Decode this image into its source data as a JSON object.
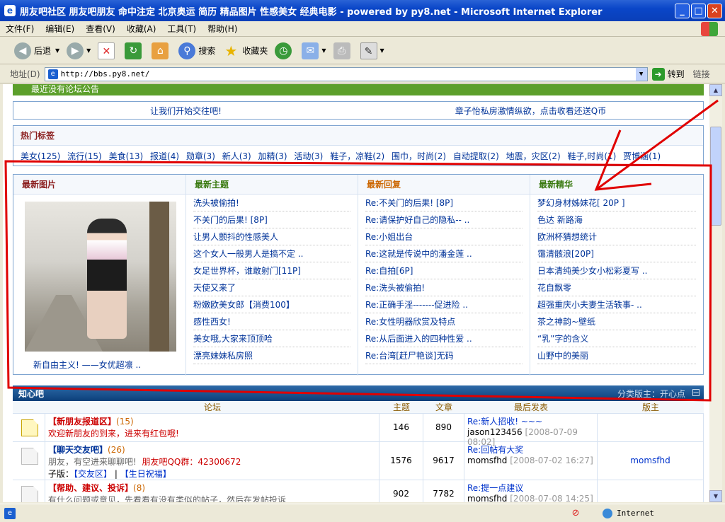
{
  "window": {
    "title": "朋友吧社区 朋友吧朋友 命中注定 北京奥运 简历 精品图片 性感美女 经典电影 - powered by py8.net - Microsoft Internet Explorer"
  },
  "menu": [
    "文件(F)",
    "编辑(E)",
    "查看(V)",
    "收藏(A)",
    "工具(T)",
    "帮助(H)"
  ],
  "toolbar": {
    "back": "后退",
    "search": "搜索",
    "favorites": "收藏夹"
  },
  "address": {
    "label": "地址(D)",
    "url": "http://bbs.py8.net/",
    "go": "转到",
    "links": "链接"
  },
  "notice": "最近没有论坛公告",
  "banner": {
    "left": "让我们开始交往吧!",
    "right": "章子怡私房激情纵欲，点击收看还送Q币"
  },
  "tags": {
    "heading": "热门标签",
    "items": [
      "美女(125)",
      "流行(15)",
      "美食(13)",
      "报道(4)",
      "勋章(3)",
      "新人(3)",
      "加精(3)",
      "活动(3)",
      "鞋子，凉鞋(2)",
      "围巾，时尚(2)",
      "自动提取(2)",
      "地震，灾区(2)",
      "鞋子,时尚(1)",
      "贾博涵(1)"
    ]
  },
  "latest": {
    "photos": {
      "heading": "最新图片",
      "caption": "新自由主义! ——女优超凛 .."
    },
    "topics": {
      "heading": "最新主题",
      "items": [
        "洗头被偷拍!",
        "不关门的后果! [8P]",
        "让男人颤抖的性感美人",
        "这个女人一般男人是搞不定 ..",
        "女足世界杯，谁敢射门[11P]",
        "天使又来了",
        "粉嫩欧美女郎【消费100】",
        "感性西女!",
        "美女哦,大家来顶顶哈",
        "漂亮妹妹私房照"
      ]
    },
    "replies": {
      "heading": "最新回复",
      "items": [
        "Re:不关门的后果! [8P]",
        "Re:请保护好自己的隐私-- ..",
        "Re:小姐出台",
        "Re:这就是传说中的潘金莲 ..",
        "Re:自拍[6P]",
        "Re:洗头被偷拍!",
        "Re:正确手淫-------促进险 ..",
        "Re:女性明器欣赏及特点",
        "Re:从后面进入的四种性爱 ..",
        "Re:台湾[赶尸艳谈]无码"
      ]
    },
    "digest": {
      "heading": "最新精华",
      "items": [
        "梦幻身材姊妹花[ 20P ]",
        "色达 新路海",
        "欧洲杯猜想统计",
        "霭清骸浪[20P]",
        "日本清纯美少女小松彩夏写 ..",
        "花自飘零",
        "超强重庆小夫妻生活轶事- ..",
        "茶之神韵~壁纸",
        "“乳”字的含义",
        "山野中的美丽"
      ]
    }
  },
  "forum": {
    "header": "知心吧",
    "moderator": "分类版主：开心点",
    "columns": [
      "论坛",
      "主题",
      "文章",
      "最后发表",
      "版主"
    ],
    "rows": [
      {
        "name": "【新朋友报道区】",
        "count": "(15)",
        "desc": "欢迎新朋友的到来，进来有红包哦!",
        "topics": "146",
        "posts": "890",
        "last_title": "Re:新人招收! ~~~",
        "last_user": "jason123456",
        "last_time": "[2008-07-09 08:02]",
        "mod": ""
      },
      {
        "name": "【聊天交友吧】",
        "count": "(26)",
        "desc": "朋友，有空进来聊聊吧!",
        "qq": "朋友吧QQ群：42300672",
        "subs_label": "子版：",
        "subs": [
          "【交友区】",
          "【生日祝福】"
        ],
        "topics": "1576",
        "posts": "9617",
        "last_title": "Re:回帖有大奖",
        "last_user": "momsfhd",
        "last_time": "[2008-07-02 16:27]",
        "mod": "momsfhd"
      },
      {
        "name": "【帮助、建议、投诉】",
        "count": "(8)",
        "desc": "有什么问题或意见，先看看有没有类似的帖子，然后在发帖投诉",
        "topics": "902",
        "posts": "7782",
        "last_title": "Re:提一点建议",
        "last_user": "momsfhd",
        "last_time": "[2008-07-08 14:25]",
        "mod": ""
      }
    ]
  },
  "status": {
    "zone": "Internet"
  },
  "colors": {
    "titlebar": "#0a46c8",
    "annotation": "#e00000",
    "link": "#003399"
  }
}
